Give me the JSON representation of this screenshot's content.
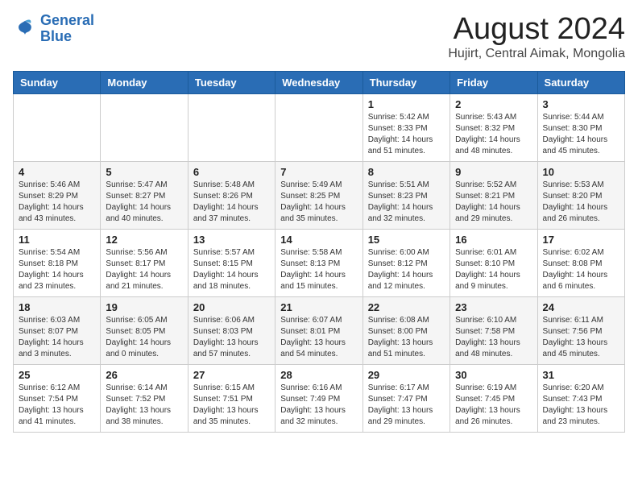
{
  "header": {
    "logo_line1": "General",
    "logo_line2": "Blue",
    "main_title": "August 2024",
    "sub_title": "Hujirt, Central Aimak, Mongolia"
  },
  "days_of_week": [
    "Sunday",
    "Monday",
    "Tuesday",
    "Wednesday",
    "Thursday",
    "Friday",
    "Saturday"
  ],
  "weeks": [
    [
      {
        "day": "",
        "content": ""
      },
      {
        "day": "",
        "content": ""
      },
      {
        "day": "",
        "content": ""
      },
      {
        "day": "",
        "content": ""
      },
      {
        "day": "1",
        "content": "Sunrise: 5:42 AM\nSunset: 8:33 PM\nDaylight: 14 hours\nand 51 minutes."
      },
      {
        "day": "2",
        "content": "Sunrise: 5:43 AM\nSunset: 8:32 PM\nDaylight: 14 hours\nand 48 minutes."
      },
      {
        "day": "3",
        "content": "Sunrise: 5:44 AM\nSunset: 8:30 PM\nDaylight: 14 hours\nand 45 minutes."
      }
    ],
    [
      {
        "day": "4",
        "content": "Sunrise: 5:46 AM\nSunset: 8:29 PM\nDaylight: 14 hours\nand 43 minutes."
      },
      {
        "day": "5",
        "content": "Sunrise: 5:47 AM\nSunset: 8:27 PM\nDaylight: 14 hours\nand 40 minutes."
      },
      {
        "day": "6",
        "content": "Sunrise: 5:48 AM\nSunset: 8:26 PM\nDaylight: 14 hours\nand 37 minutes."
      },
      {
        "day": "7",
        "content": "Sunrise: 5:49 AM\nSunset: 8:25 PM\nDaylight: 14 hours\nand 35 minutes."
      },
      {
        "day": "8",
        "content": "Sunrise: 5:51 AM\nSunset: 8:23 PM\nDaylight: 14 hours\nand 32 minutes."
      },
      {
        "day": "9",
        "content": "Sunrise: 5:52 AM\nSunset: 8:21 PM\nDaylight: 14 hours\nand 29 minutes."
      },
      {
        "day": "10",
        "content": "Sunrise: 5:53 AM\nSunset: 8:20 PM\nDaylight: 14 hours\nand 26 minutes."
      }
    ],
    [
      {
        "day": "11",
        "content": "Sunrise: 5:54 AM\nSunset: 8:18 PM\nDaylight: 14 hours\nand 23 minutes."
      },
      {
        "day": "12",
        "content": "Sunrise: 5:56 AM\nSunset: 8:17 PM\nDaylight: 14 hours\nand 21 minutes."
      },
      {
        "day": "13",
        "content": "Sunrise: 5:57 AM\nSunset: 8:15 PM\nDaylight: 14 hours\nand 18 minutes."
      },
      {
        "day": "14",
        "content": "Sunrise: 5:58 AM\nSunset: 8:13 PM\nDaylight: 14 hours\nand 15 minutes."
      },
      {
        "day": "15",
        "content": "Sunrise: 6:00 AM\nSunset: 8:12 PM\nDaylight: 14 hours\nand 12 minutes."
      },
      {
        "day": "16",
        "content": "Sunrise: 6:01 AM\nSunset: 8:10 PM\nDaylight: 14 hours\nand 9 minutes."
      },
      {
        "day": "17",
        "content": "Sunrise: 6:02 AM\nSunset: 8:08 PM\nDaylight: 14 hours\nand 6 minutes."
      }
    ],
    [
      {
        "day": "18",
        "content": "Sunrise: 6:03 AM\nSunset: 8:07 PM\nDaylight: 14 hours\nand 3 minutes."
      },
      {
        "day": "19",
        "content": "Sunrise: 6:05 AM\nSunset: 8:05 PM\nDaylight: 14 hours\nand 0 minutes."
      },
      {
        "day": "20",
        "content": "Sunrise: 6:06 AM\nSunset: 8:03 PM\nDaylight: 13 hours\nand 57 minutes."
      },
      {
        "day": "21",
        "content": "Sunrise: 6:07 AM\nSunset: 8:01 PM\nDaylight: 13 hours\nand 54 minutes."
      },
      {
        "day": "22",
        "content": "Sunrise: 6:08 AM\nSunset: 8:00 PM\nDaylight: 13 hours\nand 51 minutes."
      },
      {
        "day": "23",
        "content": "Sunrise: 6:10 AM\nSunset: 7:58 PM\nDaylight: 13 hours\nand 48 minutes."
      },
      {
        "day": "24",
        "content": "Sunrise: 6:11 AM\nSunset: 7:56 PM\nDaylight: 13 hours\nand 45 minutes."
      }
    ],
    [
      {
        "day": "25",
        "content": "Sunrise: 6:12 AM\nSunset: 7:54 PM\nDaylight: 13 hours\nand 41 minutes."
      },
      {
        "day": "26",
        "content": "Sunrise: 6:14 AM\nSunset: 7:52 PM\nDaylight: 13 hours\nand 38 minutes."
      },
      {
        "day": "27",
        "content": "Sunrise: 6:15 AM\nSunset: 7:51 PM\nDaylight: 13 hours\nand 35 minutes."
      },
      {
        "day": "28",
        "content": "Sunrise: 6:16 AM\nSunset: 7:49 PM\nDaylight: 13 hours\nand 32 minutes."
      },
      {
        "day": "29",
        "content": "Sunrise: 6:17 AM\nSunset: 7:47 PM\nDaylight: 13 hours\nand 29 minutes."
      },
      {
        "day": "30",
        "content": "Sunrise: 6:19 AM\nSunset: 7:45 PM\nDaylight: 13 hours\nand 26 minutes."
      },
      {
        "day": "31",
        "content": "Sunrise: 6:20 AM\nSunset: 7:43 PM\nDaylight: 13 hours\nand 23 minutes."
      }
    ]
  ]
}
